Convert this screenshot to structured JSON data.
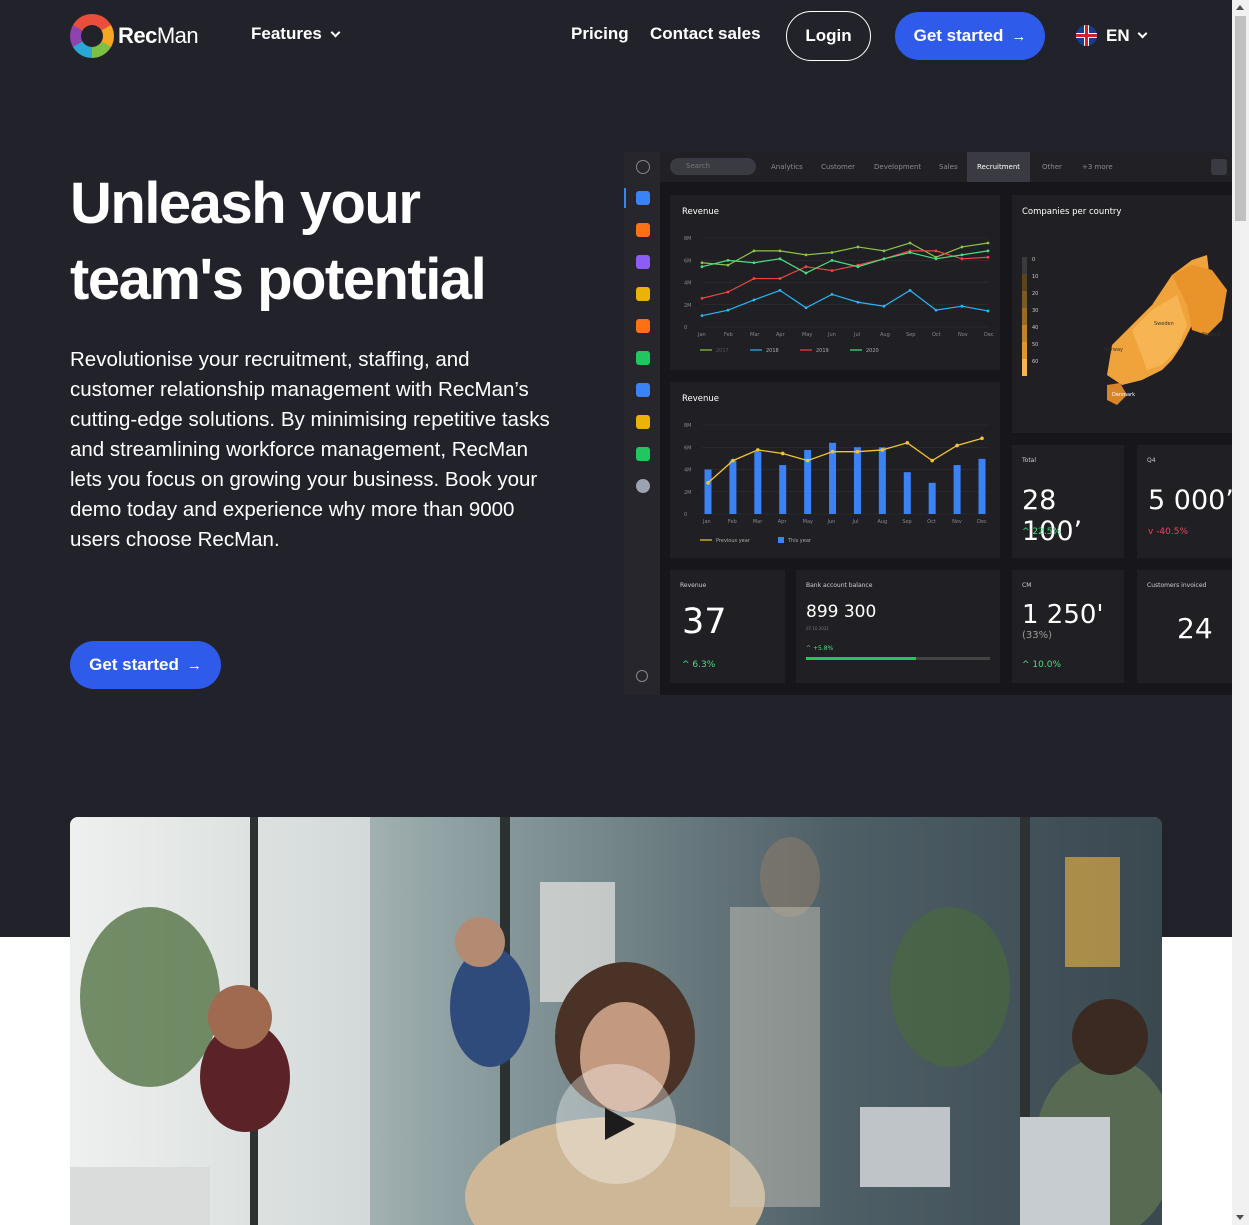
{
  "nav": {
    "logo_rec": "Rec",
    "logo_man": "Man",
    "features": "Features",
    "pricing": "Pricing",
    "contact": "Contact sales",
    "login": "Login",
    "get_started": "Get started",
    "lang": "EN"
  },
  "hero": {
    "title_line1": "Unleash your",
    "title_line2": "team's potential",
    "text": "Revolutionise your recruitment, staffing, and customer relationship management with RecMan’s cutting-edge solutions. By minimising repetitive tasks and streamlining workforce management, RecMan lets you focus on growing your business. Book your demo today and experience why more than 9000 users choose RecMan.",
    "cta": "Get started"
  },
  "dashboard": {
    "search_placeholder": "Search",
    "tabs": [
      "Analytics",
      "Customer",
      "Development",
      "Sales",
      "Recruitment",
      "Other",
      "+3 more"
    ],
    "active_tab": "Recruitment",
    "months": [
      "Jan",
      "Feb",
      "Mar",
      "Apr",
      "May",
      "Jun",
      "Jul",
      "Aug",
      "Sep",
      "Oct",
      "Nov",
      "Dec"
    ],
    "revenue_line": {
      "title": "Revenue",
      "y_ticks": [
        "8M",
        "6M",
        "4M",
        "2M",
        "0"
      ],
      "legend": [
        "2017",
        "2018",
        "2019",
        "2020"
      ],
      "colors": [
        "#8bc34a",
        "#29b6f6",
        "#ef4444",
        "#4ade80"
      ]
    },
    "revenue_bar": {
      "title": "Revenue",
      "y_ticks": [
        "8M",
        "6M",
        "4M",
        "2M",
        "0"
      ],
      "legend_prev": "Previous year",
      "legend_this": "This year",
      "bar_color": "#3b82f6",
      "line_color": "#f4c430"
    },
    "map": {
      "title": "Companies per country",
      "scale": [
        "0",
        "10",
        "20",
        "30",
        "40",
        "50",
        "60"
      ],
      "labels": [
        "Sweden",
        "Norway",
        "Finland",
        "Denmark"
      ]
    },
    "total": {
      "label": "Total",
      "value": "28 100’",
      "change": "22.5%"
    },
    "q4": {
      "label": "Q4",
      "value": "5 000’",
      "change": "-40.5%"
    },
    "revenue_small": {
      "label": "Revenue",
      "value": "37",
      "change": "6.3%"
    },
    "bank": {
      "label": "Bank account balance",
      "value": "899 300",
      "date": "07.10.2021",
      "change": "+5.8%",
      "progress": 0.6
    },
    "cm": {
      "label": "CM",
      "value": "1 250'",
      "sub": "(33%)",
      "change": "10.0%"
    },
    "invoiced": {
      "label": "Customers invoiced",
      "value": "24"
    }
  },
  "video": {
    "play_label": "Play video"
  }
}
